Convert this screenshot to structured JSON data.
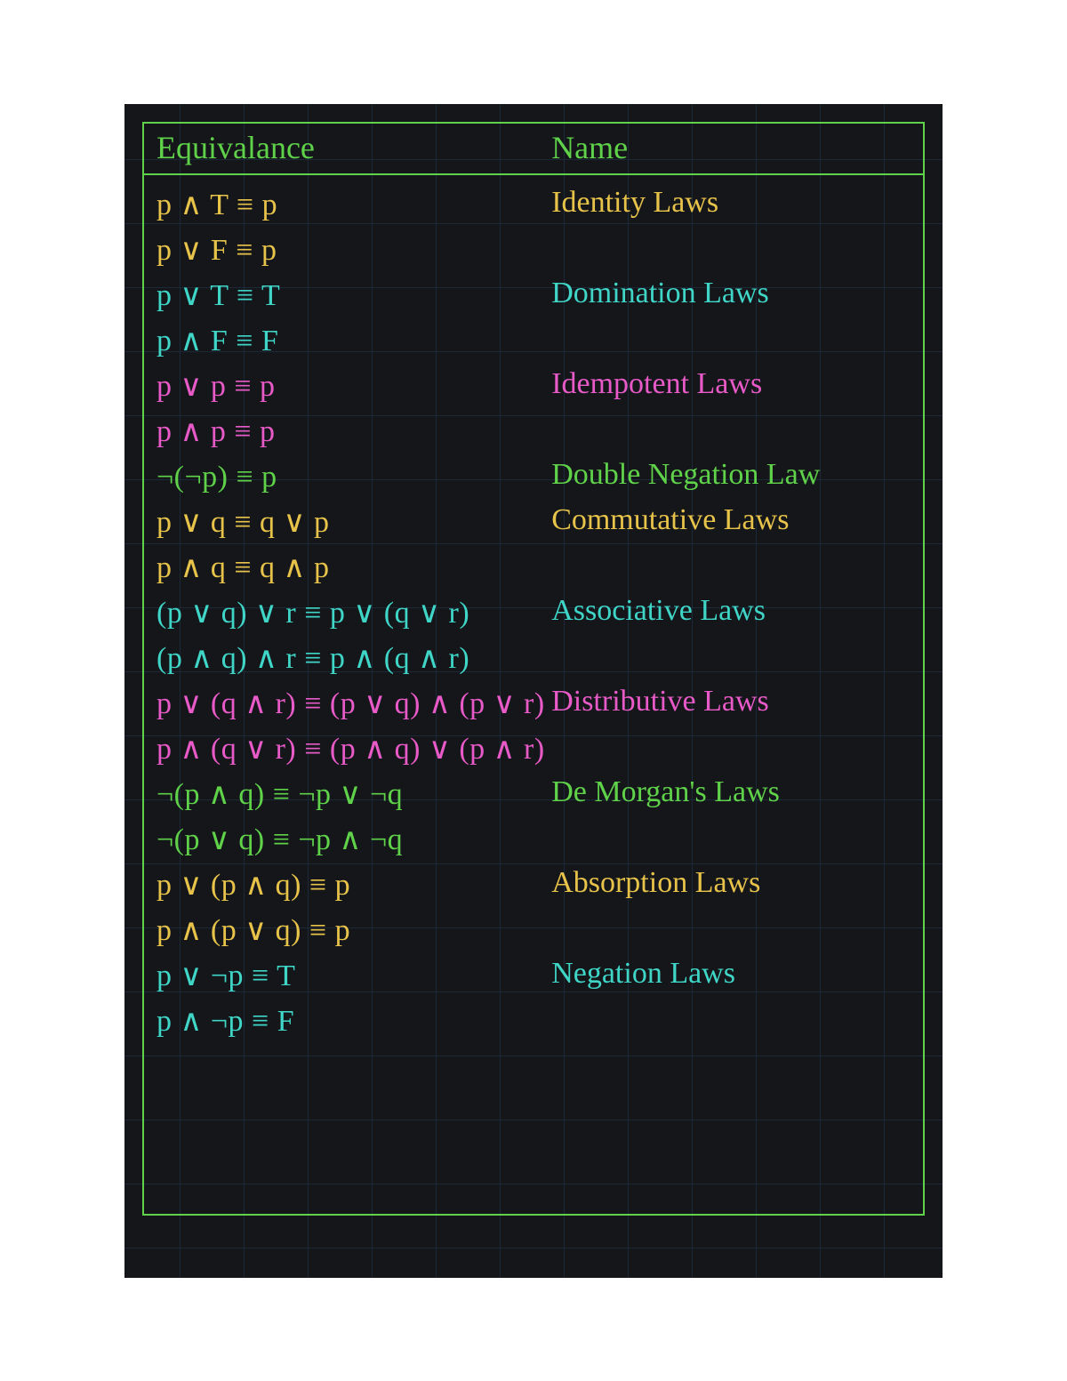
{
  "headers": {
    "equiv": "Equivalance",
    "name": "Name"
  },
  "laws": [
    {
      "name": "Identity Laws",
      "eq1": "p ∧ T ≡ p",
      "eq2": "p ∨ F ≡ p",
      "color": "c-yellow"
    },
    {
      "name": "Domination Laws",
      "eq1": "p ∨ T ≡ T",
      "eq2": "p ∧ F ≡ F",
      "color": "c-cyan"
    },
    {
      "name": "Idempotent Laws",
      "eq1": "p ∨ p ≡ p",
      "eq2": "p ∧ p ≡ p",
      "color": "c-magenta"
    },
    {
      "name": "Double Negation Law",
      "eq1": "¬(¬p) ≡ p",
      "eq2": "",
      "color": "c-green"
    },
    {
      "name": "Commutative Laws",
      "eq1": "p ∨ q ≡ q ∨ p",
      "eq2": "p ∧ q ≡ q ∧ p",
      "color": "c-yellow"
    },
    {
      "name": "Associative Laws",
      "eq1": "(p ∨ q) ∨ r ≡ p ∨ (q ∨ r)",
      "eq2": "(p ∧ q) ∧ r ≡ p ∧ (q ∧ r)",
      "color": "c-cyan"
    },
    {
      "name": "Distributive Laws",
      "eq1": "p ∨ (q ∧ r) ≡ (p ∨ q) ∧ (p ∨ r)",
      "eq2": "p ∧ (q ∨ r) ≡ (p ∧ q) ∨ (p ∧ r)",
      "color": "c-magenta"
    },
    {
      "name": "De Morgan's Laws",
      "eq1": "¬(p ∧ q) ≡ ¬p ∨ ¬q",
      "eq2": "¬(p ∨ q) ≡ ¬p ∧ ¬q",
      "color": "c-green"
    },
    {
      "name": "Absorption Laws",
      "eq1": "p ∨ (p ∧ q) ≡ p",
      "eq2": "p ∧ (p ∨ q) ≡ p",
      "color": "c-yellow"
    },
    {
      "name": "Negation Laws",
      "eq1": "p ∨ ¬p ≡ T",
      "eq2": "p ∧ ¬p ≡ F",
      "color": "c-cyan"
    }
  ]
}
